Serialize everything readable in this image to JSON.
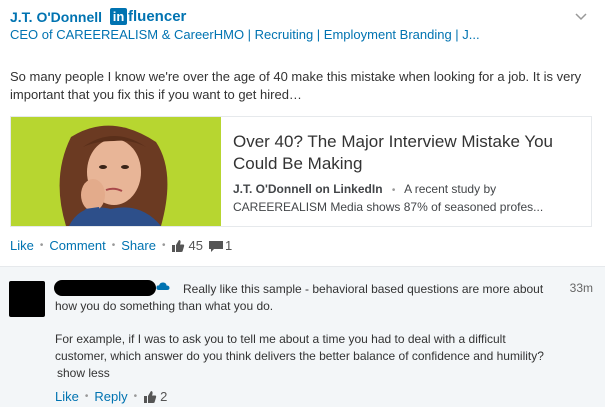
{
  "post": {
    "author_name": "J.T. O'Donnell",
    "badge": {
      "logo_letters": "in",
      "logo_rest": "fluencer"
    },
    "headline": "CEO of CAREEREALISM & CareerHMO | Recruiting | Employment Branding | J...",
    "text": "So many people I know we're over the age of 40 make this mistake when looking for a job. It is very important that you fix this if you want to get hired…",
    "article": {
      "title": "Over 40? The Major Interview Mistake You Could Be Making",
      "source": "J.T. O'Donnell on LinkedIn",
      "separator": "•",
      "summary": "A recent study by CAREEREALISM Media shows 87% of seasoned profes..."
    },
    "actions": {
      "like": "Like",
      "comment": "Comment",
      "share": "Share",
      "separator": "•",
      "like_count": "45",
      "comment_count": "1"
    }
  },
  "comment": {
    "time": "33m",
    "text_1": "Really like this sample - behavioral based questions are more about how you do something than what you do.",
    "text_2": "For example, if I was to ask you to tell me about a time you had to deal with a difficult customer, which answer do you think delivers the better balance of confidence and humility?",
    "show_less": "show less",
    "actions": {
      "like": "Like",
      "reply": "Reply",
      "separator": "•",
      "like_count": "2"
    }
  },
  "colors": {
    "link": "#0073b1",
    "comment_bg": "#f3f6f8",
    "thumb_bg": "#b7d630"
  }
}
